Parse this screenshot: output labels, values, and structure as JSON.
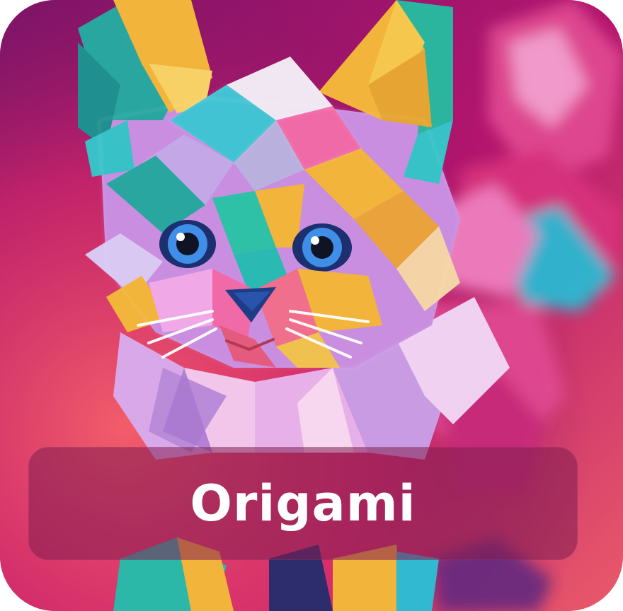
{
  "tile": {
    "label": "Origami",
    "image_icon": "origami-cat-image",
    "colors": {
      "bg_top": "#8a1a6a",
      "bg_bottom": "#f06a66",
      "label_bar": "#821e50",
      "label_text": "#ffffff",
      "paper_yellow": "#f2b43a",
      "paper_teal": "#2fb7b0",
      "paper_pink": "#e84a9a",
      "paper_blue": "#3aa8e8",
      "paper_lilac": "#c7a6e6"
    }
  }
}
